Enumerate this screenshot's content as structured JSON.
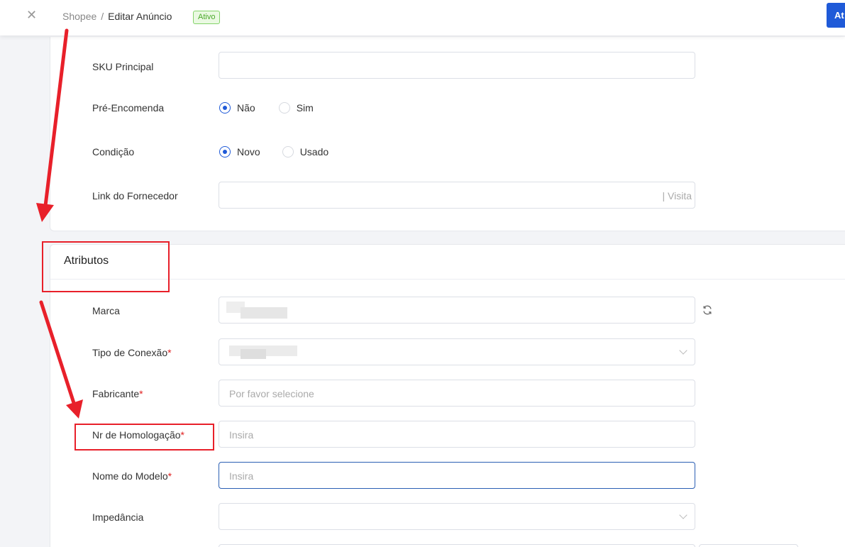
{
  "header": {
    "close_icon": "close-icon",
    "breadcrumb_root": "Shopee",
    "breadcrumb_sep": "/",
    "breadcrumb_current": "Editar Anúncio",
    "status": "Ativo",
    "top_button_label": "At"
  },
  "form": {
    "sku_label": "SKU Principal",
    "preorder_label": "Pré-Encomenda",
    "preorder_options": [
      "Não",
      "Sim"
    ],
    "preorder_selected": "Não",
    "condition_label": "Condição",
    "condition_options": [
      "Novo",
      "Usado"
    ],
    "condition_selected": "Novo",
    "supplier_link_label": "Link do Fornecedor",
    "supplier_link_suffix": "| Visita"
  },
  "attributes": {
    "title": "Atributos",
    "brand_label": "Marca",
    "connection_label": "Tipo de Conexão",
    "manufacturer_label": "Fabricante",
    "manufacturer_placeholder": "Por favor selecione",
    "homologation_label": "Nr de Homologação",
    "homologation_placeholder": "Insira",
    "model_label": "Nome do Modelo",
    "model_placeholder": "Insira",
    "impedance_label": "Impedância",
    "required_mark": "*"
  },
  "colors": {
    "primary": "#1f5ad8",
    "status_green": "#49a829",
    "required_red": "#e02020",
    "annotation_red": "#e8202a"
  }
}
